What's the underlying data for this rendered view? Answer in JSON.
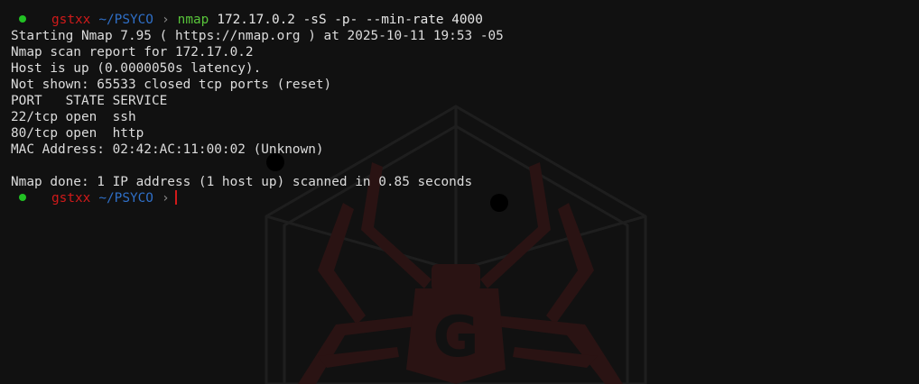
{
  "colors": {
    "background": "#111111",
    "text": "#dcdcdc",
    "prompt_dot": "#22c124",
    "prompt_user": "#d11a1a",
    "prompt_path": "#2f6fc7",
    "command": "#58c43a",
    "cursor": "#d11a1a"
  },
  "prompt": {
    "user": "gstxx",
    "path": "~/PSYCO",
    "chevron": "›"
  },
  "command": {
    "program": "nmap",
    "args": "172.17.0.2 -sS -p- --min-rate 4000"
  },
  "output": [
    "Starting Nmap 7.95 ( https://nmap.org ) at 2025-10-11 19:53 -05",
    "Nmap scan report for 172.17.0.2",
    "Host is up (0.0000050s latency).",
    "Not shown: 65533 closed tcp ports (reset)",
    "PORT   STATE SERVICE",
    "22/tcp open  ssh",
    "80/tcp open  http",
    "MAC Address: 02:42:AC:11:00:02 (Unknown)",
    "",
    "Nmap done: 1 IP address (1 host up) scanned in 0.85 seconds"
  ],
  "wallpaper": {
    "icon": "spider-emblem-icon",
    "emblem_letter": "G"
  }
}
